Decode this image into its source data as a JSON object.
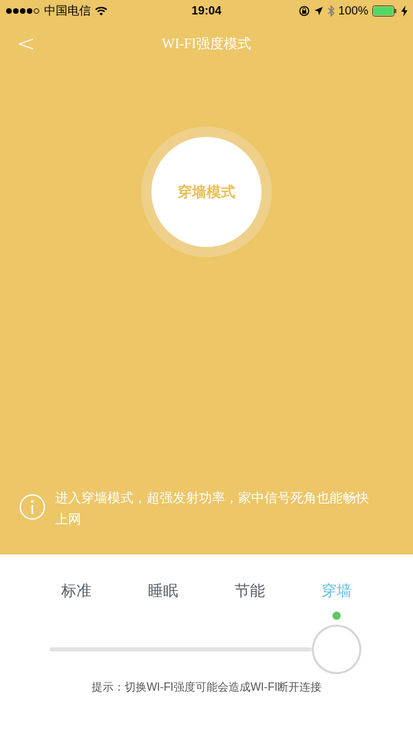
{
  "status_bar": {
    "carrier": "中国电信",
    "time": "19:04",
    "battery": "100%"
  },
  "nav": {
    "back": "<",
    "title": "WI-FI强度模式"
  },
  "mode_circle": {
    "label": "穿墙模式"
  },
  "info": {
    "text": "进入穿墙模式，超强发射功率，家中信号死角也能畅快上网"
  },
  "modes": [
    {
      "label": "标准",
      "selected": false
    },
    {
      "label": "睡眠",
      "selected": false
    },
    {
      "label": "节能",
      "selected": false
    },
    {
      "label": "穿墙",
      "selected": true
    }
  ],
  "hint": "提示：切换WI-FI强度可能会造成WI-FI断开连接"
}
